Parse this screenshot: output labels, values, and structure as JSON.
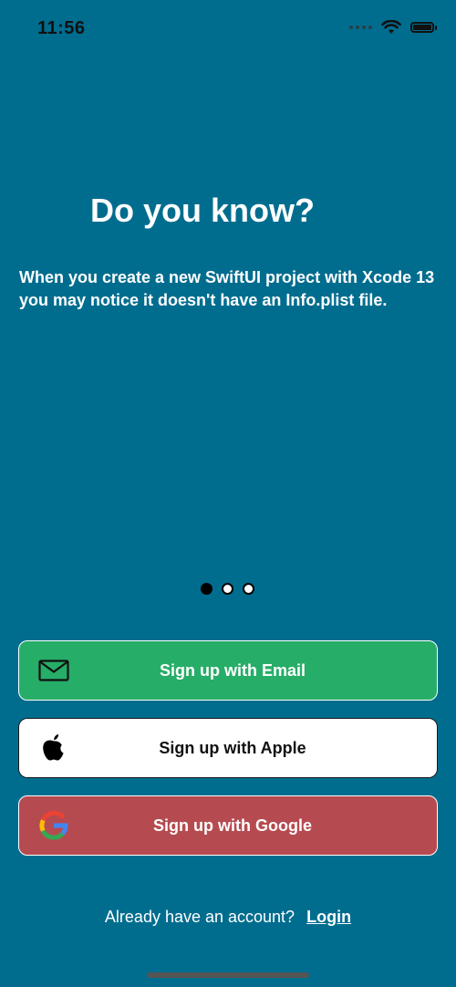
{
  "status_bar": {
    "time": "11:56",
    "icons": [
      "signal-dots-icon",
      "wifi-icon",
      "battery-icon"
    ]
  },
  "onboarding": {
    "title": "Do you know?",
    "body": "When you create a new SwiftUI project with Xcode 13 you may notice it doesn't have an Info.plist file.",
    "page_indicator": {
      "current": 1,
      "total": 3
    }
  },
  "buttons": {
    "email": {
      "label": "Sign up with Email",
      "icon": "envelope-icon",
      "color": "#26ad67"
    },
    "apple": {
      "label": "Sign up with Apple",
      "icon": "apple-icon",
      "color": "#ffffff"
    },
    "google": {
      "label": "Sign up with Google",
      "icon": "google-icon",
      "color": "#b54b50"
    }
  },
  "footer": {
    "prompt": "Already have an account?",
    "login_label": "Login"
  },
  "colors": {
    "background": "#006d8f"
  }
}
